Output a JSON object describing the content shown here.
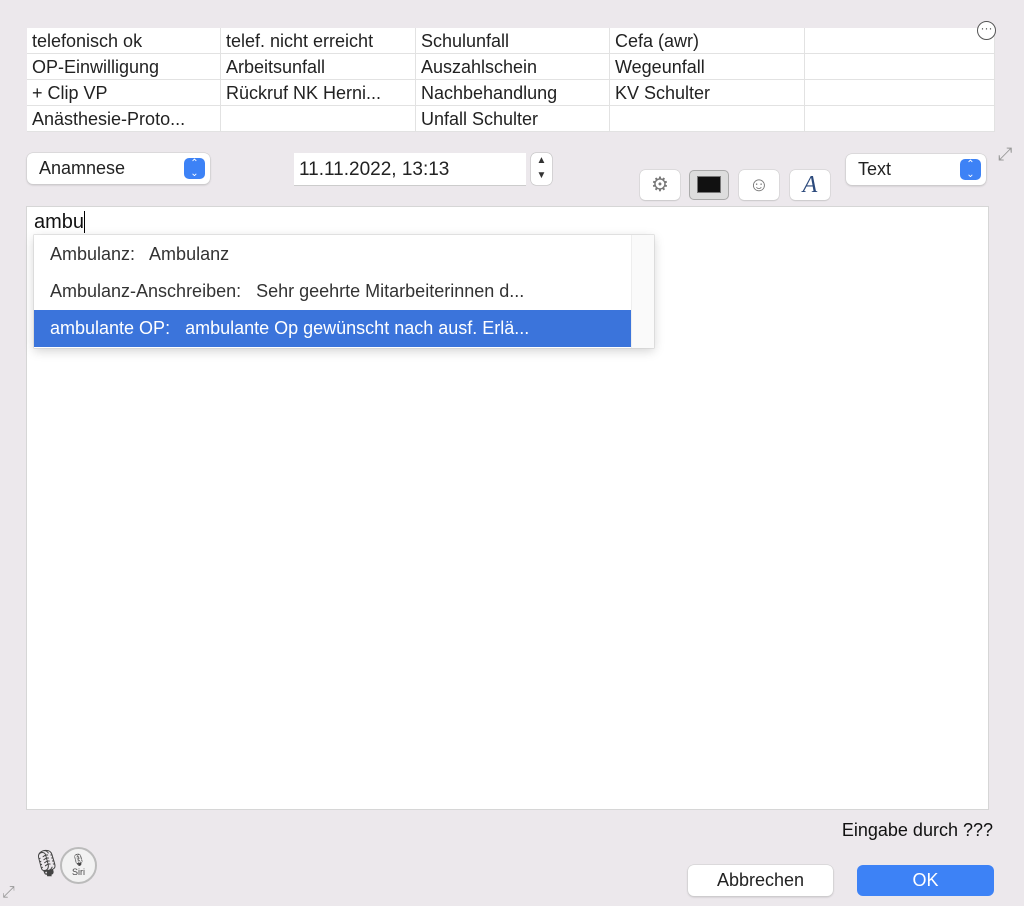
{
  "shortcuts": [
    [
      "telefonisch ok",
      "telef. nicht erreicht",
      "Schulunfall",
      "Cefa (awr)",
      ""
    ],
    [
      "OP-Einwilligung",
      "Arbeitsunfall",
      "Auszahlschein",
      "Wegeunfall",
      ""
    ],
    [
      "+ Clip VP",
      "Rückruf NK Herni...",
      "Nachbehandlung",
      "KV Schulter",
      ""
    ],
    [
      "Anästhesie-Proto...",
      "",
      "Unfall Schulter",
      "",
      ""
    ]
  ],
  "category_select": "Anamnese",
  "datetime": "11.11.2022, 13:13",
  "format_select": "Text",
  "editor": {
    "typed": "ambu"
  },
  "autocomplete": [
    {
      "text": "Ambulanz:   Ambulanz",
      "selected": false
    },
    {
      "text": "Ambulanz-Anschreiben:   Sehr geehrte Mitarbeiterinnen d...",
      "selected": false
    },
    {
      "text": "ambulante OP:   ambulante Op gewünscht nach ausf. Erlä...",
      "selected": true
    }
  ],
  "entered_by": "Eingabe durch ???",
  "siri_label": "Siri",
  "cancel_label": "Abbrechen",
  "ok_label": "OK",
  "icons": {
    "more": "ellipsis-circle-icon",
    "gear": "gear-icon",
    "color": "color-swatch-icon",
    "emoji": "smiley-icon",
    "font": "font-icon",
    "mic": "microphone-icon",
    "siri": "siri-icon",
    "expand": "expand-icon"
  },
  "colors": {
    "accent": "#3d82f6",
    "selection": "#3b74db"
  }
}
